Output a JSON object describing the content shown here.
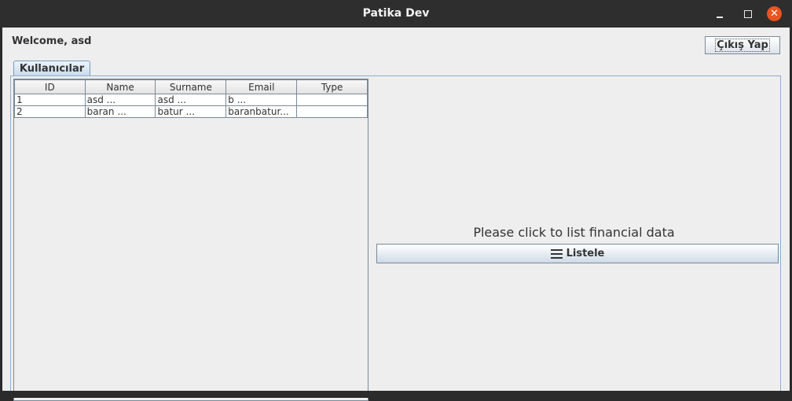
{
  "window": {
    "title": "Patika Dev"
  },
  "header": {
    "welcome": "Welcome, asd",
    "logout_label": "Çıkış Yap"
  },
  "tabs": [
    {
      "label": "Kullanıcılar"
    }
  ],
  "users_table": {
    "columns": [
      "ID",
      "Name",
      "Surname",
      "Email",
      "Type"
    ],
    "rows": [
      [
        "1",
        "asd        ...",
        "asd        ...",
        "b           ...",
        ""
      ],
      [
        "2",
        "baran      ...",
        "batur      ...",
        "baranbatur...",
        ""
      ]
    ]
  },
  "financial": {
    "prompt": "Please click to list financial data",
    "list_label": "Listele"
  },
  "icons": {
    "minimize": "minimize-icon",
    "maximize": "maximize-icon",
    "close": "close-icon",
    "list": "menu-icon"
  }
}
